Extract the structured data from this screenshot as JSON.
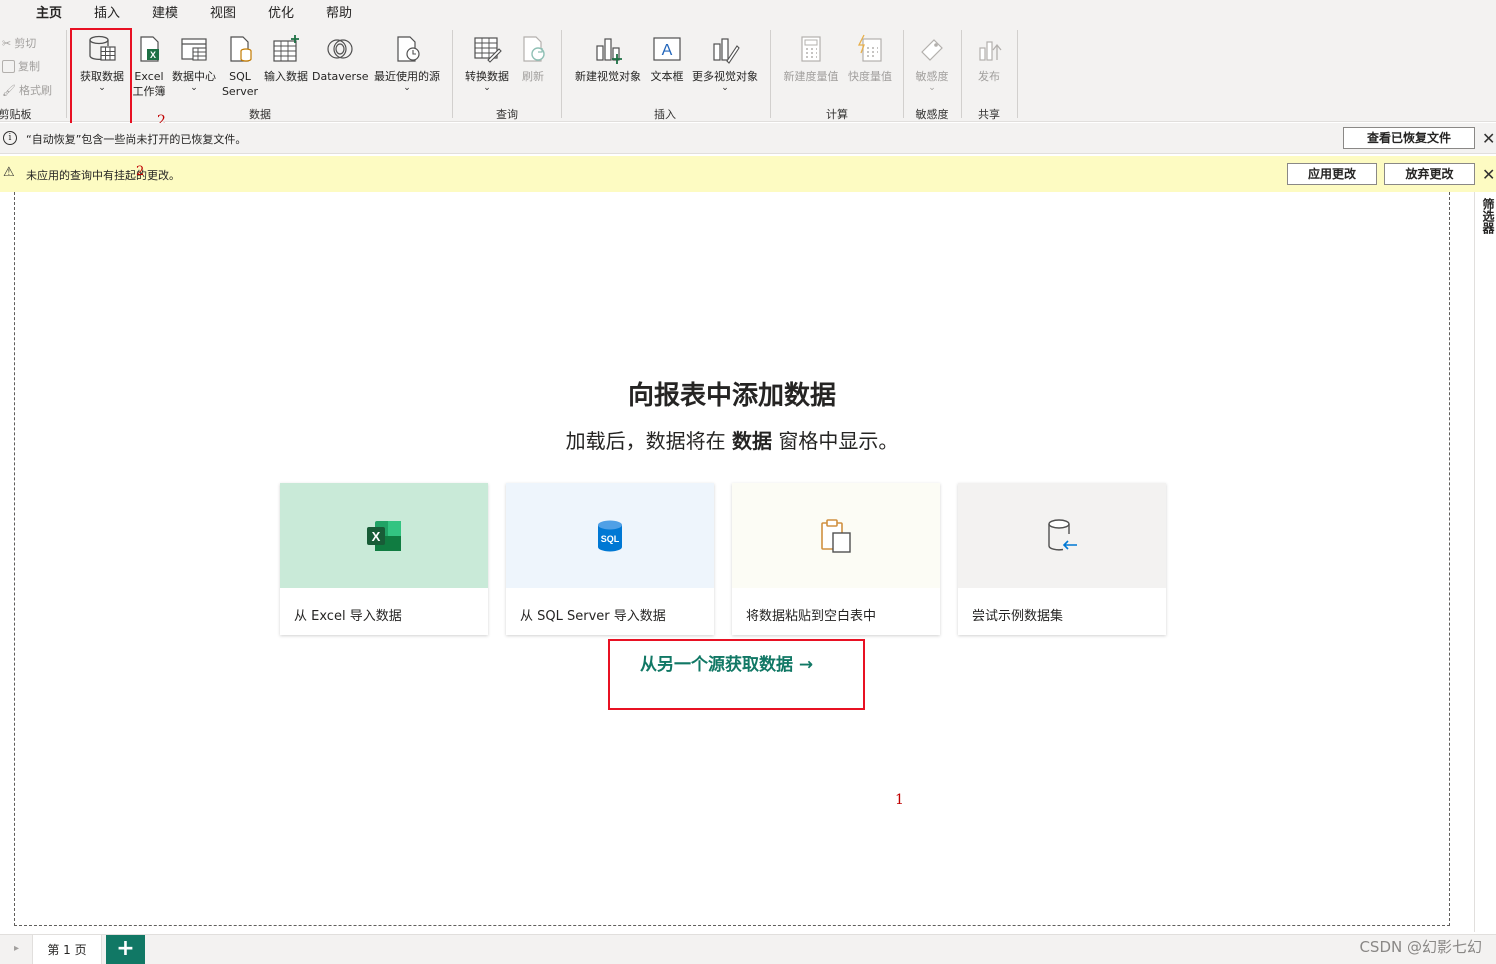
{
  "tabs": [
    "主页",
    "插入",
    "建模",
    "视图",
    "优化",
    "帮助"
  ],
  "clipboard": {
    "cut": "剪切",
    "copy": "复制",
    "format_painter": "格式刷",
    "group": "剪贴板"
  },
  "ribbon": {
    "get_data": "获取数据",
    "excel_line1": "Excel",
    "excel_line2": "工作簿",
    "data_hub": "数据中心",
    "sql_line1": "SQL",
    "sql_line2": "Server",
    "enter_data": "输入数据",
    "dataverse": "Dataverse",
    "recent_sources": "最近使用的源",
    "group_data": "数据",
    "transform": "转换数据",
    "refresh": "刷新",
    "group_query": "查询",
    "new_visual": "新建视觉对象",
    "text_box": "文本框",
    "more_visuals": "更多视觉对象",
    "group_insert": "插入",
    "new_measure": "新建度量值",
    "quick_measure": "快度量值",
    "group_calc": "计算",
    "sensitivity": "敏感度",
    "group_sensitivity": "敏感度",
    "publish": "发布",
    "group_share": "共享"
  },
  "annotations": {
    "two": "2",
    "one": "1",
    "overlap": "2"
  },
  "infobar": {
    "text": "“自动恢复”包含一些尚未打开的已恢复文件。",
    "button": "查看已恢复文件",
    "close": "✕"
  },
  "warnbar": {
    "text": "未应用的查询中有挂起的更改。",
    "apply": "应用更改",
    "discard": "放弃更改",
    "close": "✕"
  },
  "right_pane": {
    "label": "筛选器"
  },
  "hero": {
    "title": "向报表中添加数据",
    "sub_before": "加载后，数据将在 ",
    "sub_bold": "数据",
    "sub_after": " 窗格中显示。"
  },
  "cards": [
    {
      "label": "从 Excel 导入数据",
      "bg": "#c9ead8"
    },
    {
      "label": "从 SQL Server 导入数据",
      "bg": "#eef5fc"
    },
    {
      "label": "将数据粘贴到空白表中",
      "bg": "#fcfcf5"
    },
    {
      "label": "尝试示例数据集",
      "bg": "#f3f2f1"
    }
  ],
  "get_other": "从另一个源获取数据 →",
  "bottom": {
    "page_tab": "第 1 页",
    "add": "+",
    "nav": "▸"
  },
  "watermark": "CSDN @幻影七幻",
  "colors": {
    "accent": "#117865",
    "highlight": "#e81123",
    "warn_bg": "#fdfbc2"
  }
}
